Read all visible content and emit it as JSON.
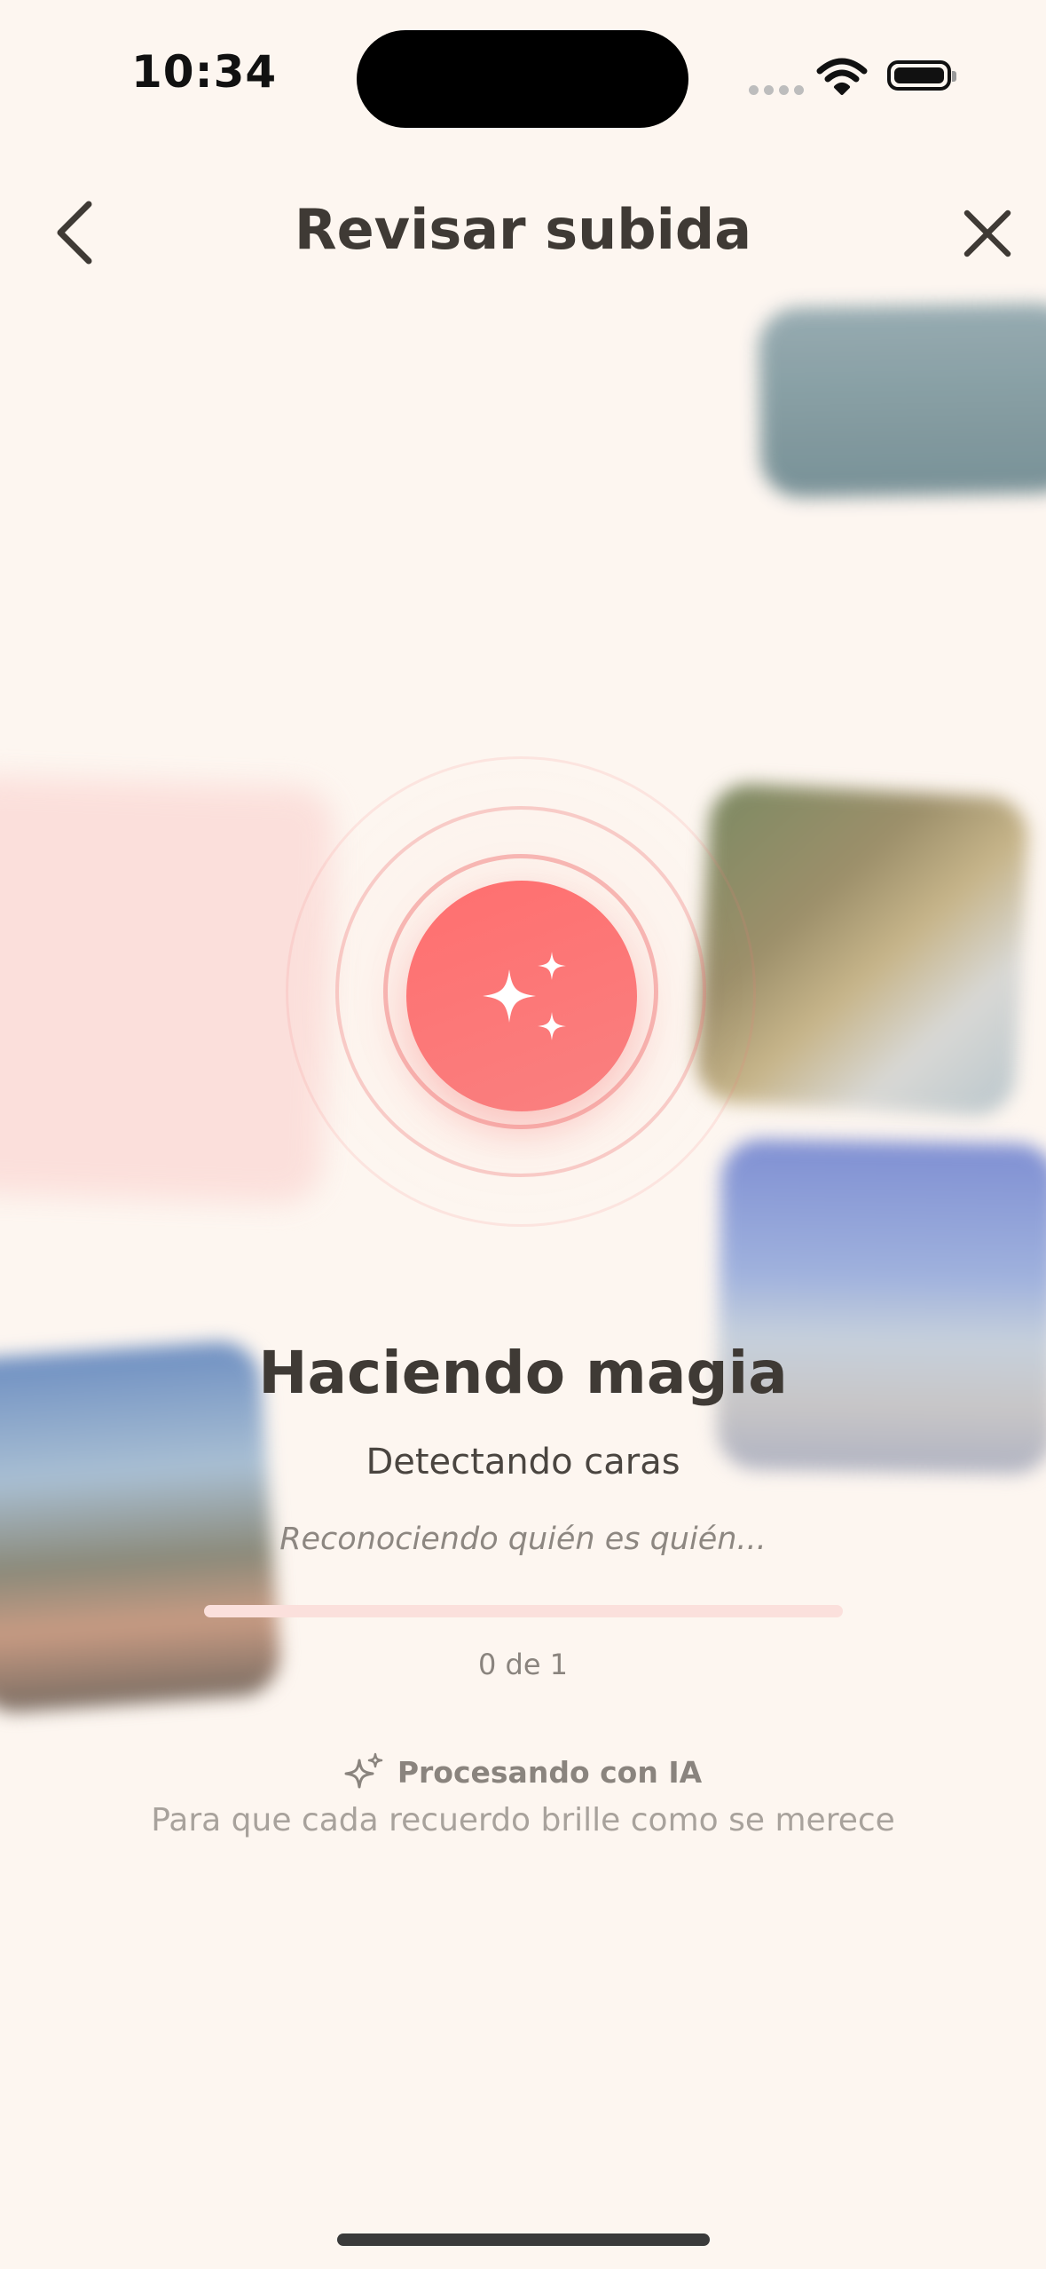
{
  "status_bar": {
    "time": "10:34"
  },
  "header": {
    "title": "Revisar subida",
    "back_icon": "chevron-left-icon",
    "close_icon": "close-icon"
  },
  "processing": {
    "heading": "Haciendo magia",
    "step": "Detectando caras",
    "description": "Reconociendo quién es quién...",
    "progress": 0,
    "count_text": "0 de 1",
    "center_icon": "sparkles-icon",
    "accent_color": "#f87575"
  },
  "footer": {
    "ai_icon": "sparkles-outline-icon",
    "ai_label": "Procesando con IA",
    "tagline": "Para que cada recuerdo brille como se merece"
  },
  "colors": {
    "background": "#fdf6f0",
    "text_primary": "#3f3a35",
    "text_muted": "#8a847e"
  }
}
